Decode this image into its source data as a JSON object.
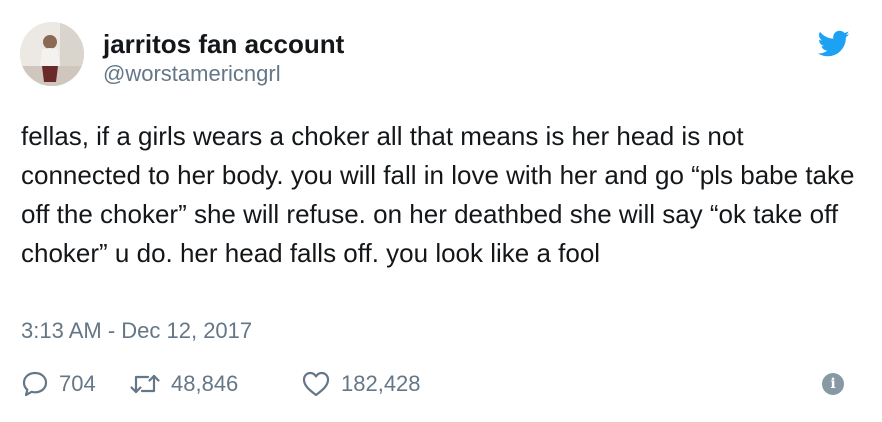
{
  "tweet": {
    "display_name": "jarritos fan account",
    "handle": "@worstamericngrl",
    "text": "fellas, if a girls wears a choker all that means is her head is not connected to her body. you will fall in love with her and go “pls babe take off the choker” she will refuse. on her deathbed she will say “ok take off choker” u do. her head falls off. you look like a fool",
    "timestamp": "3:13 AM - Dec 12, 2017"
  },
  "actions": {
    "replies": "704",
    "retweets": "48,846",
    "likes": "182,428"
  },
  "icons": {
    "brand": "twitter-bird-icon",
    "reply": "speech-bubble-icon",
    "retweet": "retweet-arrows-icon",
    "like": "heart-icon",
    "info": "info-icon"
  },
  "colors": {
    "brand": "#1da1f2",
    "secondary_text": "#657786",
    "primary_text": "#14171a"
  }
}
